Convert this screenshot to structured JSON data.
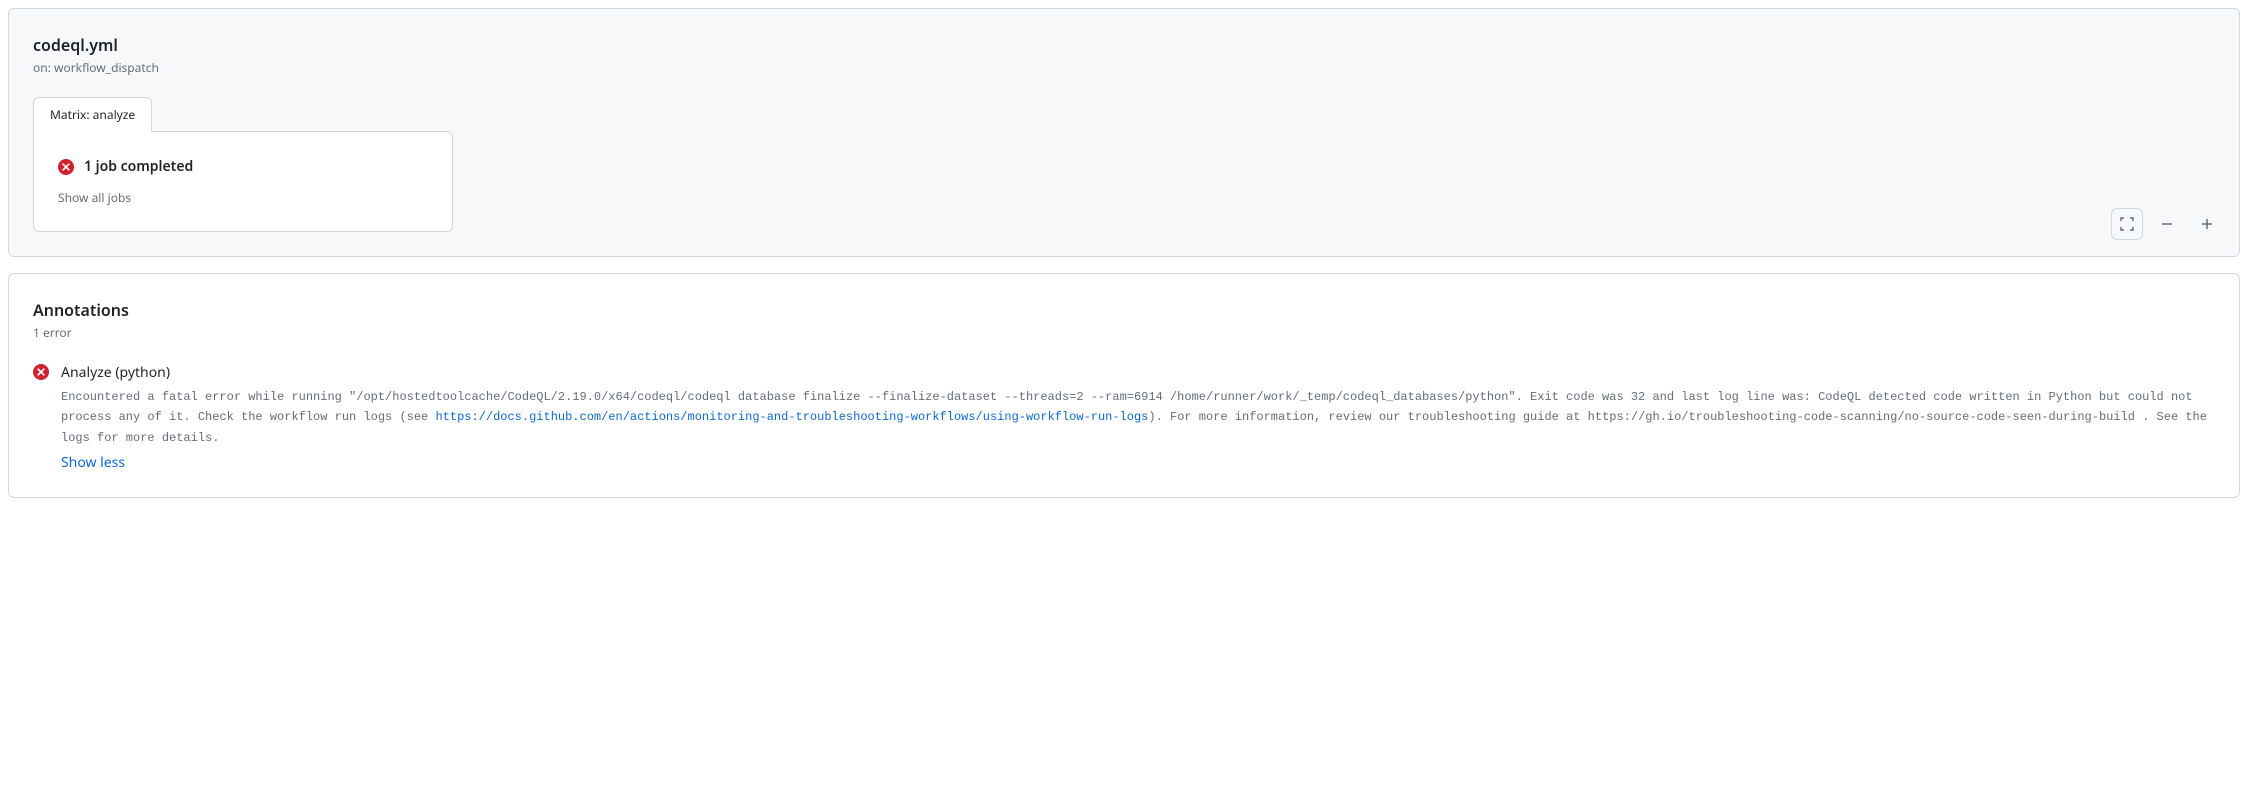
{
  "workflow": {
    "title": "codeql.yml",
    "subtitle": "on: workflow_dispatch",
    "matrix_tab": "Matrix: analyze",
    "job_status": "1 job completed",
    "show_all_jobs": "Show all jobs"
  },
  "annotations": {
    "title": "Annotations",
    "count": "1 error",
    "items": [
      {
        "heading": "Analyze (python)",
        "body_pre": "Encountered a fatal error while running \"/opt/hostedtoolcache/CodeQL/2.19.0/x64/codeql/codeql database finalize --finalize-dataset --threads=2 --ram=6914 /home/runner/work/_temp/codeql_databases/python\". Exit code was 32 and last log line was: CodeQL detected code written in Python but could not process any of it. Check the workflow run logs (see ",
        "body_link_text": "https://docs.github.com/en/actions/monitoring-and-troubleshooting-workflows/using-workflow-run-logs",
        "body_post": "). For more information, review our troubleshooting guide at https://gh.io/troubleshooting-code-scanning/no-source-code-seen-during-build . See the logs for more details.",
        "show_less": "Show less"
      }
    ]
  }
}
